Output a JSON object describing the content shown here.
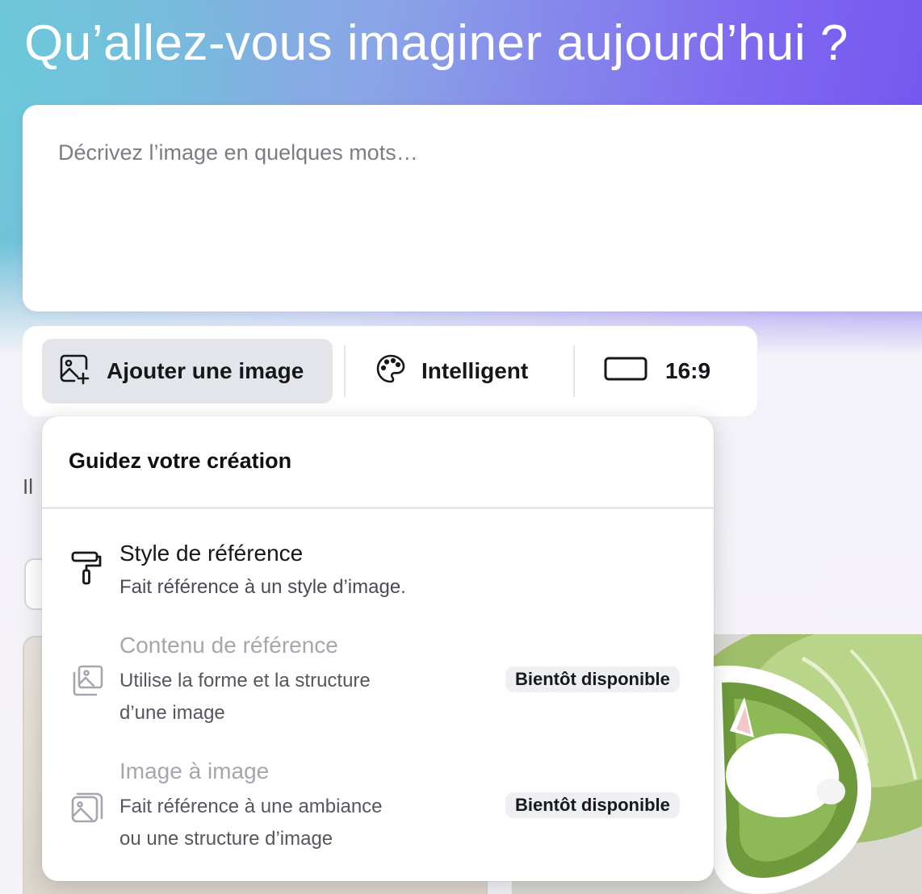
{
  "headline": "Qu’allez-vous imaginer aujourd’hui ?",
  "prompt": {
    "placeholder": "Décrivez l’image en quelques mots…",
    "value": ""
  },
  "toolbar": {
    "add_image_label": "Ajouter une image",
    "style_label": "Intelligent",
    "aspect_ratio_label": "16:9"
  },
  "background": {
    "partial_text": "Il"
  },
  "dropdown": {
    "title": "Guidez votre création",
    "items": [
      {
        "icon": "paint-roller-icon",
        "title": "Style de référence",
        "description": "Fait référence à un style d’image.",
        "enabled": true,
        "badge": ""
      },
      {
        "icon": "image-stack-icon",
        "title": "Contenu de référence",
        "description_line1": "Utilise la forme et la structure",
        "description_line2": "d’une image",
        "enabled": false,
        "badge": "Bientôt disponible"
      },
      {
        "icon": "image-copy-icon",
        "title": "Image à image",
        "description_line1": "Fait référence à une ambiance",
        "description_line2": "ou une structure d’image",
        "enabled": false,
        "badge": "Bientôt disponible"
      }
    ]
  },
  "colors": {
    "gradient_start": "#6fc4d6",
    "gradient_end": "#6b4cf0",
    "active_button_bg": "#e4e5ea",
    "badge_bg": "#eeeff3",
    "disabled_text": "#a5a7ae"
  }
}
